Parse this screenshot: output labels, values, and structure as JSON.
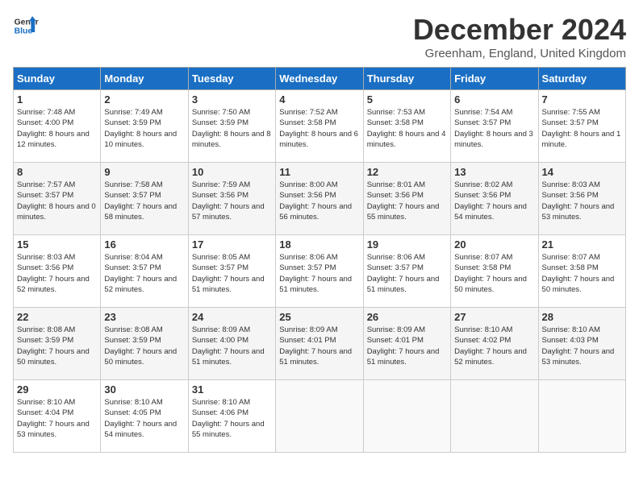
{
  "logo": {
    "line1": "General",
    "line2": "Blue"
  },
  "title": "December 2024",
  "location": "Greenham, England, United Kingdom",
  "days_of_week": [
    "Sunday",
    "Monday",
    "Tuesday",
    "Wednesday",
    "Thursday",
    "Friday",
    "Saturday"
  ],
  "weeks": [
    [
      {
        "day": "1",
        "sunrise": "7:48 AM",
        "sunset": "4:00 PM",
        "daylight": "8 hours and 12 minutes."
      },
      {
        "day": "2",
        "sunrise": "7:49 AM",
        "sunset": "3:59 PM",
        "daylight": "8 hours and 10 minutes."
      },
      {
        "day": "3",
        "sunrise": "7:50 AM",
        "sunset": "3:59 PM",
        "daylight": "8 hours and 8 minutes."
      },
      {
        "day": "4",
        "sunrise": "7:52 AM",
        "sunset": "3:58 PM",
        "daylight": "8 hours and 6 minutes."
      },
      {
        "day": "5",
        "sunrise": "7:53 AM",
        "sunset": "3:58 PM",
        "daylight": "8 hours and 4 minutes."
      },
      {
        "day": "6",
        "sunrise": "7:54 AM",
        "sunset": "3:57 PM",
        "daylight": "8 hours and 3 minutes."
      },
      {
        "day": "7",
        "sunrise": "7:55 AM",
        "sunset": "3:57 PM",
        "daylight": "8 hours and 1 minute."
      }
    ],
    [
      {
        "day": "8",
        "sunrise": "7:57 AM",
        "sunset": "3:57 PM",
        "daylight": "8 hours and 0 minutes."
      },
      {
        "day": "9",
        "sunrise": "7:58 AM",
        "sunset": "3:57 PM",
        "daylight": "7 hours and 58 minutes."
      },
      {
        "day": "10",
        "sunrise": "7:59 AM",
        "sunset": "3:56 PM",
        "daylight": "7 hours and 57 minutes."
      },
      {
        "day": "11",
        "sunrise": "8:00 AM",
        "sunset": "3:56 PM",
        "daylight": "7 hours and 56 minutes."
      },
      {
        "day": "12",
        "sunrise": "8:01 AM",
        "sunset": "3:56 PM",
        "daylight": "7 hours and 55 minutes."
      },
      {
        "day": "13",
        "sunrise": "8:02 AM",
        "sunset": "3:56 PM",
        "daylight": "7 hours and 54 minutes."
      },
      {
        "day": "14",
        "sunrise": "8:03 AM",
        "sunset": "3:56 PM",
        "daylight": "7 hours and 53 minutes."
      }
    ],
    [
      {
        "day": "15",
        "sunrise": "8:03 AM",
        "sunset": "3:56 PM",
        "daylight": "7 hours and 52 minutes."
      },
      {
        "day": "16",
        "sunrise": "8:04 AM",
        "sunset": "3:57 PM",
        "daylight": "7 hours and 52 minutes."
      },
      {
        "day": "17",
        "sunrise": "8:05 AM",
        "sunset": "3:57 PM",
        "daylight": "7 hours and 51 minutes."
      },
      {
        "day": "18",
        "sunrise": "8:06 AM",
        "sunset": "3:57 PM",
        "daylight": "7 hours and 51 minutes."
      },
      {
        "day": "19",
        "sunrise": "8:06 AM",
        "sunset": "3:57 PM",
        "daylight": "7 hours and 51 minutes."
      },
      {
        "day": "20",
        "sunrise": "8:07 AM",
        "sunset": "3:58 PM",
        "daylight": "7 hours and 50 minutes."
      },
      {
        "day": "21",
        "sunrise": "8:07 AM",
        "sunset": "3:58 PM",
        "daylight": "7 hours and 50 minutes."
      }
    ],
    [
      {
        "day": "22",
        "sunrise": "8:08 AM",
        "sunset": "3:59 PM",
        "daylight": "7 hours and 50 minutes."
      },
      {
        "day": "23",
        "sunrise": "8:08 AM",
        "sunset": "3:59 PM",
        "daylight": "7 hours and 50 minutes."
      },
      {
        "day": "24",
        "sunrise": "8:09 AM",
        "sunset": "4:00 PM",
        "daylight": "7 hours and 51 minutes."
      },
      {
        "day": "25",
        "sunrise": "8:09 AM",
        "sunset": "4:01 PM",
        "daylight": "7 hours and 51 minutes."
      },
      {
        "day": "26",
        "sunrise": "8:09 AM",
        "sunset": "4:01 PM",
        "daylight": "7 hours and 51 minutes."
      },
      {
        "day": "27",
        "sunrise": "8:10 AM",
        "sunset": "4:02 PM",
        "daylight": "7 hours and 52 minutes."
      },
      {
        "day": "28",
        "sunrise": "8:10 AM",
        "sunset": "4:03 PM",
        "daylight": "7 hours and 53 minutes."
      }
    ],
    [
      {
        "day": "29",
        "sunrise": "8:10 AM",
        "sunset": "4:04 PM",
        "daylight": "7 hours and 53 minutes."
      },
      {
        "day": "30",
        "sunrise": "8:10 AM",
        "sunset": "4:05 PM",
        "daylight": "7 hours and 54 minutes."
      },
      {
        "day": "31",
        "sunrise": "8:10 AM",
        "sunset": "4:06 PM",
        "daylight": "7 hours and 55 minutes."
      },
      null,
      null,
      null,
      null
    ]
  ]
}
